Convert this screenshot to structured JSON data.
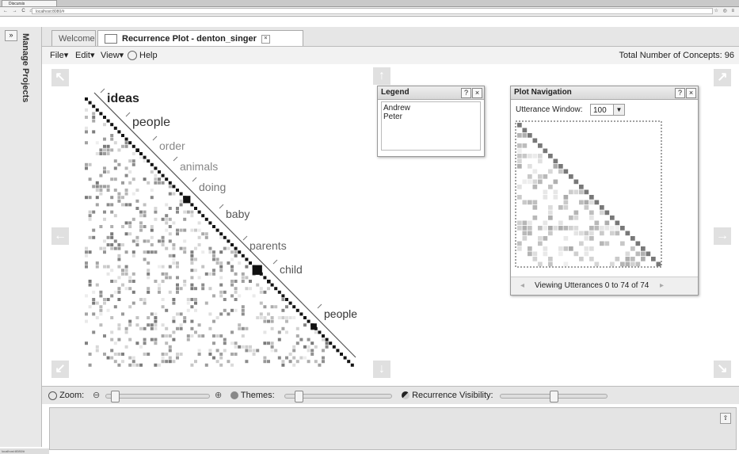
{
  "browser": {
    "tab_title": "Discursis",
    "url": "localhost:8080/#",
    "nav_glyphs": "← → C ⌂",
    "right_glyphs": "☆ ◎ ≡"
  },
  "sidebar": {
    "expand_label": "»",
    "title": "Manage Projects"
  },
  "tabs": [
    {
      "label": "Welcome"
    },
    {
      "label": "Recurrence Plot - denton_singer",
      "close_label": "×"
    }
  ],
  "menu": {
    "items": [
      "File▾",
      "Edit▾",
      "View▾",
      "Help"
    ],
    "total_concepts": "Total Number of Concepts: 96"
  },
  "plot": {
    "concept_labels": [
      "ideas",
      "people",
      "order",
      "animals",
      "doing",
      "baby",
      "parents",
      "child",
      "people"
    ],
    "label_colors": [
      "#222",
      "#333",
      "#888",
      "#888",
      "#777",
      "#555",
      "#666",
      "#555",
      "#333"
    ],
    "arrow_icons": [
      "arrow-up-left-icon",
      "arrow-up-icon",
      "arrow-up-right-icon",
      "arrow-left-icon",
      "arrow-right-icon",
      "arrow-down-left-icon",
      "arrow-down-icon",
      "arrow-down-right-icon"
    ]
  },
  "legend": {
    "title": "Legend",
    "help_label": "?",
    "close_label": "×",
    "speakers": [
      "Andrew",
      "Peter"
    ]
  },
  "plot_navigation": {
    "title": "Plot Navigation",
    "help_label": "?",
    "close_label": "×",
    "window_label": "Utterance Window:",
    "window_value": "100",
    "viewing_text": "Viewing Utterances 0 to 74 of 74",
    "prev_glyph": "◂",
    "next_glyph": "▸"
  },
  "bottom": {
    "zoom_label": "Zoom:",
    "zoom_value": 0.05,
    "themes_label": "Themes:",
    "themes_value": 0.1,
    "recurrence_label": "Recurrence Visibility:",
    "recurrence_value": 0.5
  },
  "console": {
    "toggle_label": "⇧"
  },
  "statusbar": {
    "text": "localhost:8080/#"
  }
}
